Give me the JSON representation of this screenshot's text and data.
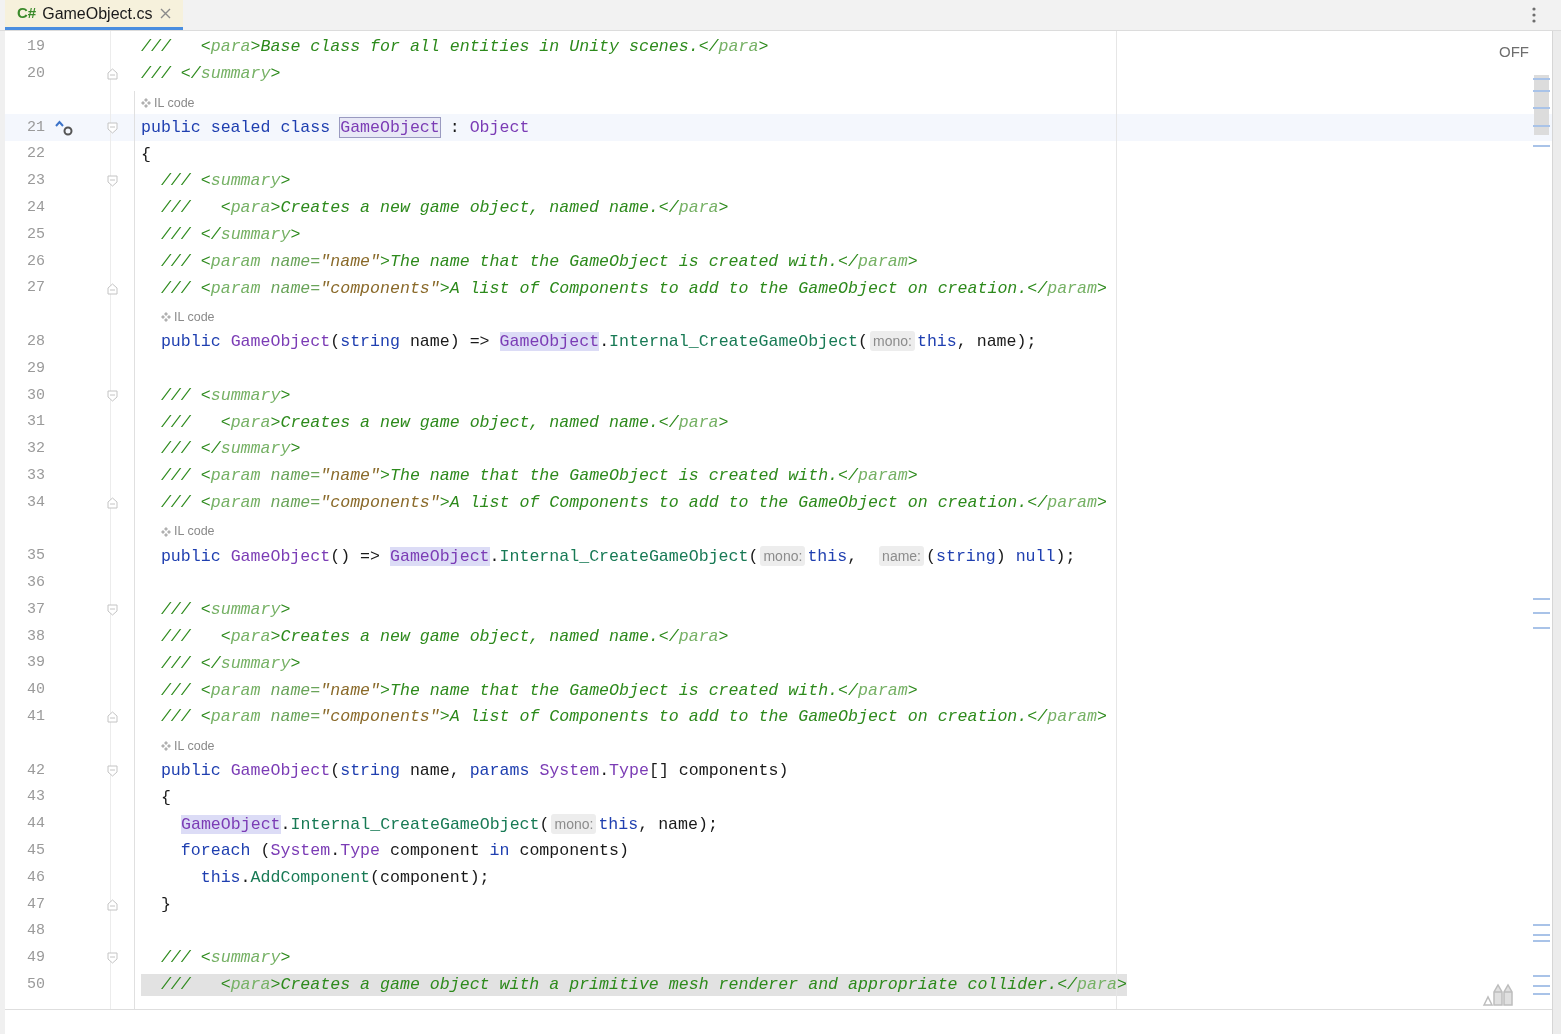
{
  "tab": {
    "language": "C#",
    "title": "GameObject.cs",
    "selected": true
  },
  "inspection": "OFF",
  "lines": [
    {
      "kind": "code",
      "number": "19",
      "tokens": [
        {
          "text": "///   <",
          "kind": "comment"
        },
        {
          "text": "para",
          "kind": "tag"
        },
        {
          "text": ">Base class for all entities in Unity scenes.</",
          "kind": "comment"
        },
        {
          "text": "para",
          "kind": "tag"
        },
        {
          "text": ">",
          "kind": "comment"
        }
      ]
    },
    {
      "kind": "code",
      "number": "20",
      "fold_end": true,
      "tokens": [
        {
          "text": "/// </",
          "kind": "comment"
        },
        {
          "text": "summary",
          "kind": "tag"
        },
        {
          "text": ">",
          "kind": "comment"
        }
      ]
    },
    {
      "kind": "il",
      "label": "IL code"
    },
    {
      "kind": "code",
      "number": "21",
      "fold_start": true,
      "gutter_icons": true,
      "caret_line": true,
      "tokens": [
        {
          "text": "public sealed class ",
          "kind": "keyword"
        },
        {
          "text": "GameObject",
          "kind": "type",
          "declaration": true
        },
        {
          "text": " : ",
          "kind": "plain"
        },
        {
          "text": "Object",
          "kind": "type"
        }
      ]
    },
    {
      "kind": "code",
      "number": "22",
      "tokens": [
        {
          "text": "{",
          "kind": "plain"
        }
      ]
    },
    {
      "kind": "code",
      "number": "23",
      "fold_start": true,
      "tokens": [
        {
          "text": "  /// <",
          "kind": "comment"
        },
        {
          "text": "summary",
          "kind": "tag"
        },
        {
          "text": ">",
          "kind": "comment"
        }
      ]
    },
    {
      "kind": "code",
      "number": "24",
      "tokens": [
        {
          "text": "  ///   <",
          "kind": "comment"
        },
        {
          "text": "para",
          "kind": "tag"
        },
        {
          "text": ">Creates a new game object, named name.</",
          "kind": "comment"
        },
        {
          "text": "para",
          "kind": "tag"
        },
        {
          "text": ">",
          "kind": "comment"
        }
      ]
    },
    {
      "kind": "code",
      "number": "25",
      "tokens": [
        {
          "text": "  /// </",
          "kind": "comment"
        },
        {
          "text": "summary",
          "kind": "tag"
        },
        {
          "text": ">",
          "kind": "comment"
        }
      ]
    },
    {
      "kind": "code",
      "number": "26",
      "tokens": [
        {
          "text": "  /// <",
          "kind": "comment"
        },
        {
          "text": "param",
          "kind": "tag"
        },
        {
          "text": " name=",
          "kind": "attr"
        },
        {
          "text": "\"name\"",
          "kind": "value"
        },
        {
          "text": ">The name that the GameObject is created with.</",
          "kind": "comment"
        },
        {
          "text": "param",
          "kind": "tag"
        },
        {
          "text": ">",
          "kind": "comment"
        }
      ]
    },
    {
      "kind": "code",
      "number": "27",
      "fold_end": true,
      "tokens": [
        {
          "text": "  /// <",
          "kind": "comment"
        },
        {
          "text": "param",
          "kind": "tag"
        },
        {
          "text": " name=",
          "kind": "attr"
        },
        {
          "text": "\"components\"",
          "kind": "value"
        },
        {
          "text": ">A list of Components to add to the GameObject on creation.</",
          "kind": "comment"
        },
        {
          "text": "param",
          "kind": "tag"
        },
        {
          "text": ">",
          "kind": "comment"
        }
      ]
    },
    {
      "kind": "il",
      "label": "IL code"
    },
    {
      "kind": "code",
      "number": "28",
      "tokens": [
        {
          "text": "  public ",
          "kind": "keyword"
        },
        {
          "text": "GameObject",
          "kind": "type"
        },
        {
          "text": "(",
          "kind": "plain"
        },
        {
          "text": "string",
          "kind": "keyword"
        },
        {
          "text": " name) => ",
          "kind": "plain"
        },
        {
          "text": "GameObject",
          "kind": "type",
          "usage": true
        },
        {
          "text": ".",
          "kind": "plain"
        },
        {
          "text": "Internal_CreateGameObject",
          "kind": "method"
        },
        {
          "text": "(",
          "kind": "plain"
        },
        {
          "text": "mono:",
          "kind": "hint"
        },
        {
          "text": "this",
          "kind": "keyword"
        },
        {
          "text": ", name);",
          "kind": "plain"
        }
      ]
    },
    {
      "kind": "code",
      "number": "29"
    },
    {
      "kind": "code",
      "number": "30",
      "fold_start": true,
      "tokens": [
        {
          "text": "  /// <",
          "kind": "comment"
        },
        {
          "text": "summary",
          "kind": "tag"
        },
        {
          "text": ">",
          "kind": "comment"
        }
      ]
    },
    {
      "kind": "code",
      "number": "31",
      "tokens": [
        {
          "text": "  ///   <",
          "kind": "comment"
        },
        {
          "text": "para",
          "kind": "tag"
        },
        {
          "text": ">Creates a new game object, named name.</",
          "kind": "comment"
        },
        {
          "text": "para",
          "kind": "tag"
        },
        {
          "text": ">",
          "kind": "comment"
        }
      ]
    },
    {
      "kind": "code",
      "number": "32",
      "tokens": [
        {
          "text": "  /// </",
          "kind": "comment"
        },
        {
          "text": "summary",
          "kind": "tag"
        },
        {
          "text": ">",
          "kind": "comment"
        }
      ]
    },
    {
      "kind": "code",
      "number": "33",
      "tokens": [
        {
          "text": "  /// <",
          "kind": "comment"
        },
        {
          "text": "param",
          "kind": "tag"
        },
        {
          "text": " name=",
          "kind": "attr"
        },
        {
          "text": "\"name\"",
          "kind": "value"
        },
        {
          "text": ">The name that the GameObject is created with.</",
          "kind": "comment"
        },
        {
          "text": "param",
          "kind": "tag"
        },
        {
          "text": ">",
          "kind": "comment"
        }
      ]
    },
    {
      "kind": "code",
      "number": "34",
      "fold_end": true,
      "tokens": [
        {
          "text": "  /// <",
          "kind": "comment"
        },
        {
          "text": "param",
          "kind": "tag"
        },
        {
          "text": " name=",
          "kind": "attr"
        },
        {
          "text": "\"components\"",
          "kind": "value"
        },
        {
          "text": ">A list of Components to add to the GameObject on creation.</",
          "kind": "comment"
        },
        {
          "text": "param",
          "kind": "tag"
        },
        {
          "text": ">",
          "kind": "comment"
        }
      ]
    },
    {
      "kind": "il",
      "label": "IL code"
    },
    {
      "kind": "code",
      "number": "35",
      "tokens": [
        {
          "text": "  public ",
          "kind": "keyword"
        },
        {
          "text": "GameObject",
          "kind": "type"
        },
        {
          "text": "() => ",
          "kind": "plain"
        },
        {
          "text": "GameObject",
          "kind": "type",
          "usage": true
        },
        {
          "text": ".",
          "kind": "plain"
        },
        {
          "text": "Internal_CreateGameObject",
          "kind": "method"
        },
        {
          "text": "(",
          "kind": "plain"
        },
        {
          "text": "mono:",
          "kind": "hint"
        },
        {
          "text": "this",
          "kind": "keyword"
        },
        {
          "text": ",  ",
          "kind": "plain"
        },
        {
          "text": "name:",
          "kind": "hint"
        },
        {
          "text": "(",
          "kind": "plain"
        },
        {
          "text": "string",
          "kind": "keyword"
        },
        {
          "text": ") ",
          "kind": "plain"
        },
        {
          "text": "null",
          "kind": "keyword"
        },
        {
          "text": ");",
          "kind": "plain"
        }
      ]
    },
    {
      "kind": "code",
      "number": "36"
    },
    {
      "kind": "code",
      "number": "37",
      "fold_start": true,
      "tokens": [
        {
          "text": "  /// <",
          "kind": "comment"
        },
        {
          "text": "summary",
          "kind": "tag"
        },
        {
          "text": ">",
          "kind": "comment"
        }
      ]
    },
    {
      "kind": "code",
      "number": "38",
      "tokens": [
        {
          "text": "  ///   <",
          "kind": "comment"
        },
        {
          "text": "para",
          "kind": "tag"
        },
        {
          "text": ">Creates a new game object, named name.</",
          "kind": "comment"
        },
        {
          "text": "para",
          "kind": "tag"
        },
        {
          "text": ">",
          "kind": "comment"
        }
      ]
    },
    {
      "kind": "code",
      "number": "39",
      "tokens": [
        {
          "text": "  /// </",
          "kind": "comment"
        },
        {
          "text": "summary",
          "kind": "tag"
        },
        {
          "text": ">",
          "kind": "comment"
        }
      ]
    },
    {
      "kind": "code",
      "number": "40",
      "tokens": [
        {
          "text": "  /// <",
          "kind": "comment"
        },
        {
          "text": "param",
          "kind": "tag"
        },
        {
          "text": " name=",
          "kind": "attr"
        },
        {
          "text": "\"name\"",
          "kind": "value"
        },
        {
          "text": ">The name that the GameObject is created with.</",
          "kind": "comment"
        },
        {
          "text": "param",
          "kind": "tag"
        },
        {
          "text": ">",
          "kind": "comment"
        }
      ]
    },
    {
      "kind": "code",
      "number": "41",
      "fold_end": true,
      "tokens": [
        {
          "text": "  /// <",
          "kind": "comment"
        },
        {
          "text": "param",
          "kind": "tag"
        },
        {
          "text": " name=",
          "kind": "attr"
        },
        {
          "text": "\"components\"",
          "kind": "value"
        },
        {
          "text": ">A list of Components to add to the GameObject on creation.</",
          "kind": "comment"
        },
        {
          "text": "param",
          "kind": "tag"
        },
        {
          "text": ">",
          "kind": "comment"
        }
      ]
    },
    {
      "kind": "il",
      "label": "IL code"
    },
    {
      "kind": "code",
      "number": "42",
      "fold_start": true,
      "tokens": [
        {
          "text": "  public ",
          "kind": "keyword"
        },
        {
          "text": "GameObject",
          "kind": "type"
        },
        {
          "text": "(",
          "kind": "plain"
        },
        {
          "text": "string",
          "kind": "keyword"
        },
        {
          "text": " name, ",
          "kind": "plain"
        },
        {
          "text": "params ",
          "kind": "keyword"
        },
        {
          "text": "System",
          "kind": "type"
        },
        {
          "text": ".",
          "kind": "plain"
        },
        {
          "text": "Type",
          "kind": "type"
        },
        {
          "text": "[] components)",
          "kind": "plain"
        }
      ]
    },
    {
      "kind": "code",
      "number": "43",
      "tokens": [
        {
          "text": "  {",
          "kind": "plain"
        }
      ]
    },
    {
      "kind": "code",
      "number": "44",
      "tokens": [
        {
          "text": "    GameObject",
          "kind": "type",
          "usage": true
        },
        {
          "text": ".",
          "kind": "plain"
        },
        {
          "text": "Internal_CreateGameObject",
          "kind": "method"
        },
        {
          "text": "(",
          "kind": "plain"
        },
        {
          "text": "mono:",
          "kind": "hint"
        },
        {
          "text": "this",
          "kind": "keyword"
        },
        {
          "text": ", name);",
          "kind": "plain"
        }
      ]
    },
    {
      "kind": "code",
      "number": "45",
      "tokens": [
        {
          "text": "    foreach ",
          "kind": "keyword"
        },
        {
          "text": "(",
          "kind": "plain"
        },
        {
          "text": "System",
          "kind": "type"
        },
        {
          "text": ".",
          "kind": "plain"
        },
        {
          "text": "Type",
          "kind": "type"
        },
        {
          "text": " component ",
          "kind": "plain"
        },
        {
          "text": "in",
          "kind": "keyword"
        },
        {
          "text": " components)",
          "kind": "plain"
        }
      ]
    },
    {
      "kind": "code",
      "number": "46",
      "tokens": [
        {
          "text": "      this",
          "kind": "keyword"
        },
        {
          "text": ".",
          "kind": "plain"
        },
        {
          "text": "AddComponent",
          "kind": "method"
        },
        {
          "text": "(component);",
          "kind": "plain"
        }
      ]
    },
    {
      "kind": "code",
      "number": "47",
      "fold_end": true,
      "tokens": [
        {
          "text": "  }",
          "kind": "plain"
        }
      ]
    },
    {
      "kind": "code",
      "number": "48"
    },
    {
      "kind": "code",
      "number": "49",
      "fold_start": true,
      "tokens": [
        {
          "text": "  /// <",
          "kind": "comment"
        },
        {
          "text": "summary",
          "kind": "tag"
        },
        {
          "text": ">",
          "kind": "comment"
        }
      ]
    },
    {
      "kind": "code",
      "number": "50",
      "selection": true,
      "tokens": [
        {
          "text": "  ///   <",
          "kind": "comment"
        },
        {
          "text": "para",
          "kind": "tag"
        },
        {
          "text": ">Creates a game object with a primitive mesh renderer and appropriate collider.</",
          "kind": "comment"
        },
        {
          "text": "para",
          "kind": "tag"
        },
        {
          "text": ">",
          "kind": "comment"
        }
      ]
    }
  ]
}
